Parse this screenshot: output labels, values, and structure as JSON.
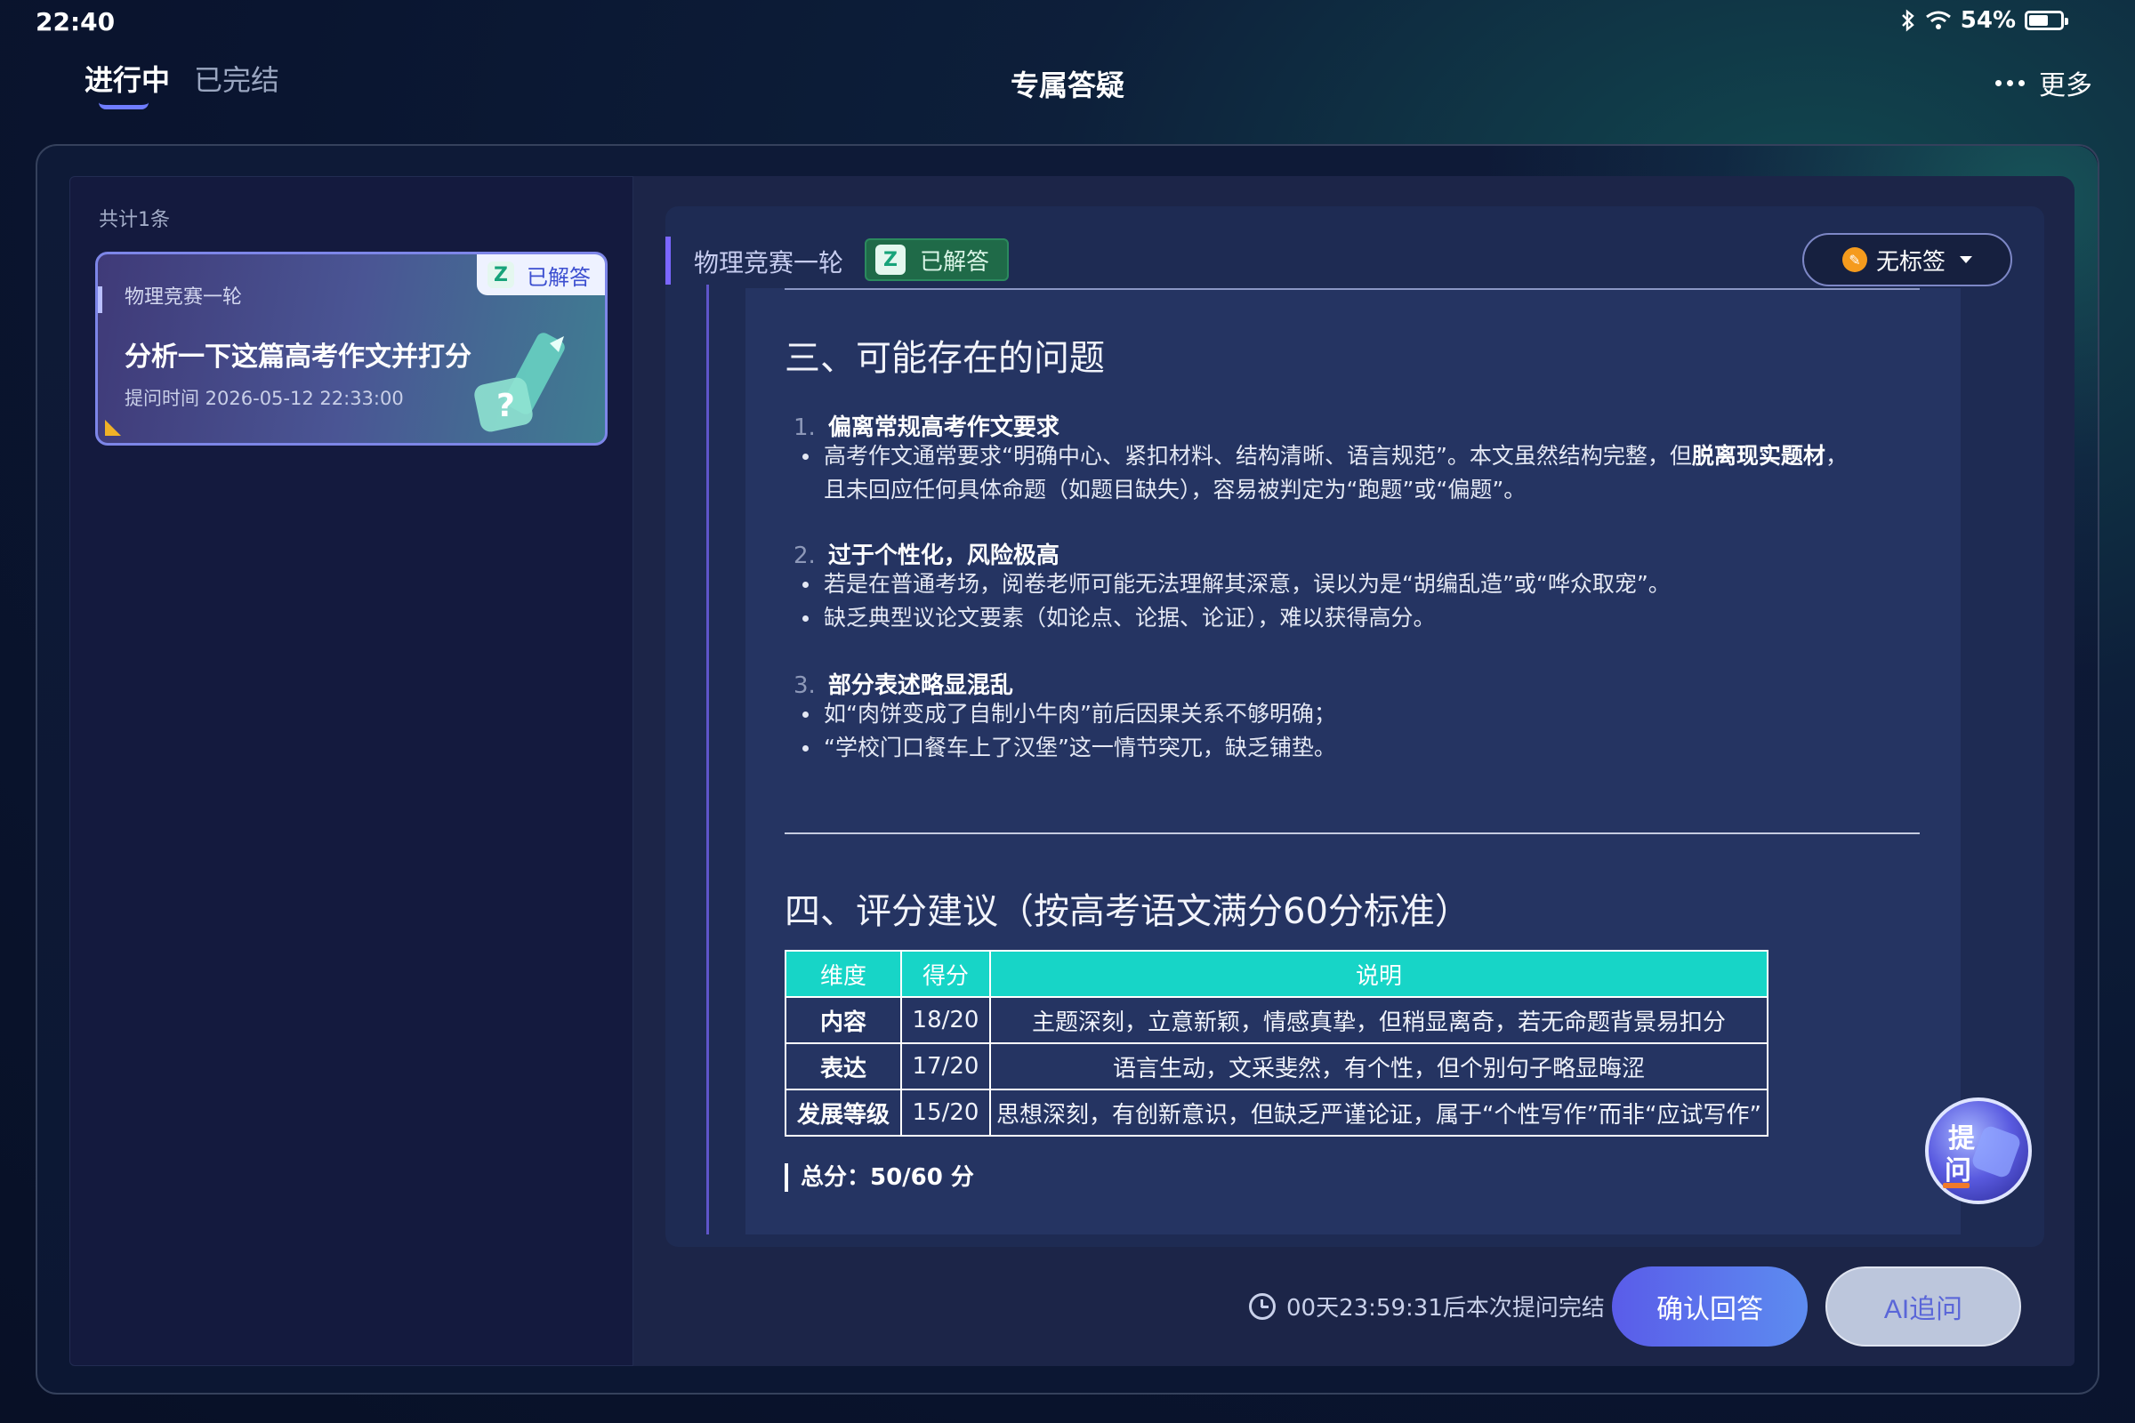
{
  "status_bar": {
    "time": "22:40",
    "battery": "54%",
    "battery_level": 0.54
  },
  "header": {
    "tabs": [
      {
        "label": "进行中",
        "active": true
      },
      {
        "label": "已完结",
        "active": false
      }
    ],
    "title": "专属答疑",
    "more_label": "更多"
  },
  "list_panel": {
    "count_text": "共计1条",
    "items": [
      {
        "subject": "物理竞赛一轮",
        "title": "分析一下这篇高考作文并打分",
        "time": "提问时间 2026-05-12 22:33:00",
        "status": "已解答",
        "status_icon": "Z"
      }
    ]
  },
  "answer": {
    "subject": "物理竞赛一轮",
    "status": "已解答",
    "status_icon": "Z",
    "tag_select": "无标签",
    "section3": {
      "heading": "三、可能存在的问题",
      "items": [
        {
          "num": "1.",
          "title": "偏离常规高考作文要求",
          "b1_prefix": "高考作文通常要求“明确中心、紧扣材料、结构清晰、语言规范”。本文虽然结构完整，但",
          "b1_bold": "脱离现实题材",
          "b1_suffix": "，",
          "b1_cont": "且未回应任何具体命题（如题目缺失），容易被判定为“跑题”或“偏题”。"
        },
        {
          "num": "2.",
          "title": "过于个性化，风险极高",
          "b1": "若是在普通考场，阅卷老师可能无法理解其深意，误以为是“胡编乱造”或“哗众取宠”。",
          "b2": "缺乏典型议论文要素（如论点、论据、论证），难以获得高分。"
        },
        {
          "num": "3.",
          "title": "部分表述略显混乱",
          "b1": "如“肉饼变成了自制小牛肉”前后因果关系不够明确；",
          "b2": "“学校门口餐车上了汉堡”这一情节突兀，缺乏铺垫。"
        }
      ]
    },
    "section4": {
      "heading": "四、评分建议（按高考语文满分60分标准）",
      "table": {
        "headers": [
          "维度",
          "得分",
          "说明"
        ],
        "rows": [
          [
            "内容",
            "18/20",
            "主题深刻，立意新颖，情感真挚，但稍显离奇，若无命题背景易扣分"
          ],
          [
            "表达",
            "17/20",
            "语言生动，文采斐然，有个性，但个别句子略显晦涩"
          ],
          [
            "发展等级",
            "15/20",
            "思想深刻，有创新意识，但缺乏严谨论证，属于“个性写作”而非“应试写作”"
          ]
        ]
      },
      "total": "总分：50/60 分"
    }
  },
  "ask_button": {
    "label_line1": "提",
    "label_line2": "问"
  },
  "footer": {
    "countdown": "00天23:59:31后本次提问完结",
    "confirm_label": "确认回答",
    "ai_label": "AI追问"
  },
  "colors": {
    "accent": "#5a5ce9",
    "table_header": "#17d5c7",
    "badge_green": "#1f6a48"
  }
}
